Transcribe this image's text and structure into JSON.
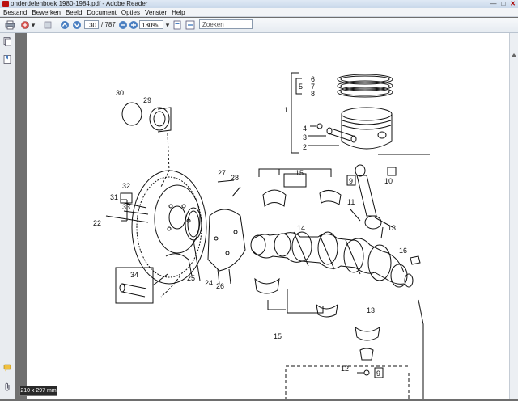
{
  "window": {
    "title": "onderdelenboek 1980-1984.pdf - Adobe Reader"
  },
  "menu": [
    "Bestand",
    "Bewerken",
    "Beeld",
    "Document",
    "Opties",
    "Venster",
    "Help"
  ],
  "toolbar": {
    "page_current": "30",
    "page_total": "/ 787",
    "zoom": "130%",
    "search_placeholder": "Zoeken"
  },
  "status": {
    "page_size": "210 x 297 mm"
  },
  "diagram_labels": {
    "l1": "1",
    "l2": "2",
    "l3": "3",
    "l4": "4",
    "l5": "5",
    "l6": "6",
    "l7": "7",
    "l8": "8",
    "l9a": "9",
    "l9b": "9",
    "l10": "10",
    "l11": "11",
    "l12": "12",
    "l13a": "13",
    "l13b": "13",
    "l14": "14",
    "l15a": "15",
    "l15b": "15",
    "l16": "16",
    "l22": "22",
    "l24": "24",
    "l25": "25",
    "l26": "26",
    "l27": "27",
    "l28": "28",
    "l29": "29",
    "l30": "30",
    "l31": "31",
    "l32": "32",
    "l33": "33",
    "l34": "34"
  },
  "colors": {
    "window_bg": "#6e6e6e",
    "page_bg": "#ffffff",
    "line": "#111111"
  }
}
